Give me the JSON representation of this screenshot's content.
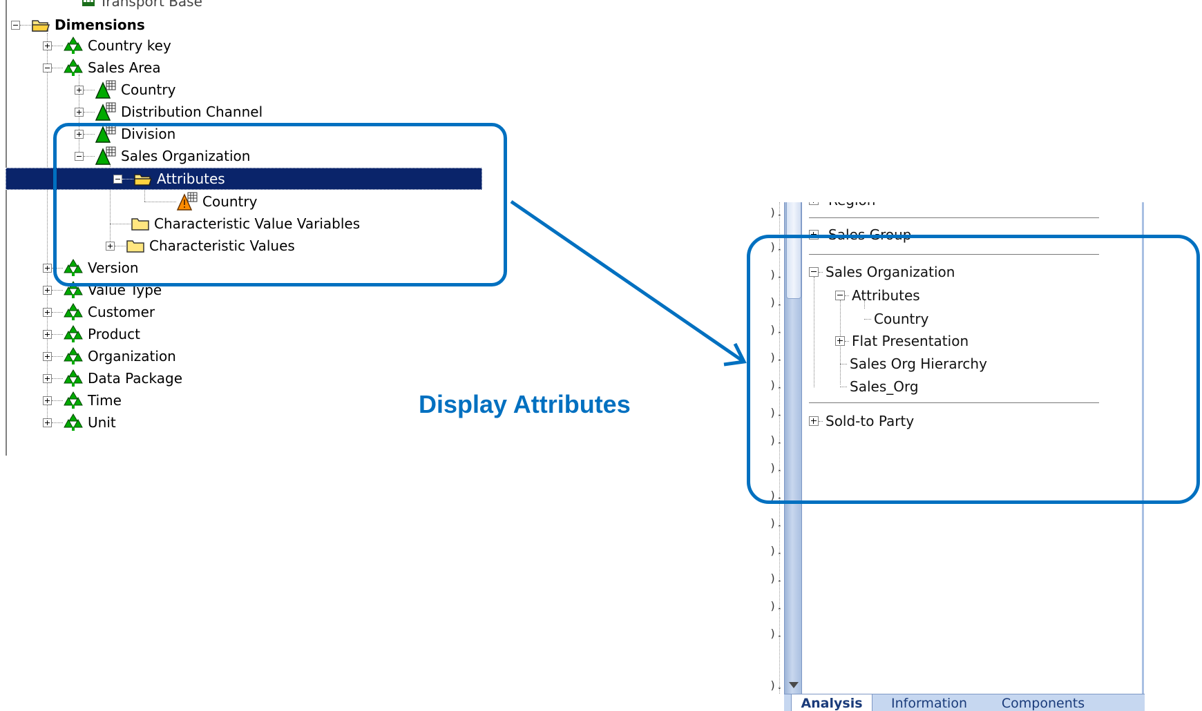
{
  "left_tree": {
    "top_partial_label": "Transport Base",
    "nodes": [
      {
        "label": "Dimensions"
      },
      {
        "label": "Country key"
      },
      {
        "label": "Sales Area"
      },
      {
        "label": "Country"
      },
      {
        "label": "Distribution Channel"
      },
      {
        "label": "Division"
      },
      {
        "label": "Sales Organization"
      },
      {
        "label": "Attributes"
      },
      {
        "label": "Country"
      },
      {
        "label": "Characteristic Value Variables"
      },
      {
        "label": "Characteristic Values"
      },
      {
        "label": "Version"
      },
      {
        "label": "Value Type"
      },
      {
        "label": "Customer"
      },
      {
        "label": "Product"
      },
      {
        "label": "Organization"
      },
      {
        "label": "Data Package"
      },
      {
        "label": "Time"
      },
      {
        "label": "Unit"
      }
    ]
  },
  "caption": "Display Attributes",
  "right_panel": {
    "partial_top_label": "Region",
    "nodes": [
      {
        "label": "Sales Group"
      },
      {
        "label": "Sales Organization"
      },
      {
        "label": "Attributes"
      },
      {
        "label": "Country"
      },
      {
        "label": "Flat Presentation"
      },
      {
        "label": "Sales Org Hierarchy"
      },
      {
        "label": "Sales_Org"
      },
      {
        "label": "Sold-to Party"
      }
    ],
    "gutter_marks": [
      ").",
      ").",
      ").",
      ").",
      ").",
      ").",
      ").",
      ").",
      ").",
      ").",
      ").",
      ").",
      ").",
      ").",
      ").",
      ").",
      ")."
    ],
    "tabs": [
      {
        "label": "Analysis",
        "active": true
      },
      {
        "label": "Information",
        "active": false
      },
      {
        "label": "Components",
        "active": false
      }
    ]
  },
  "colors": {
    "callout": "#0070c0",
    "selection": "#0a246a",
    "dimension_icon": "#00aa00",
    "folder": "#ffe680"
  },
  "icons": {
    "dimension": "green-hierarchy-icon",
    "characteristic": "green-triangle-grid-icon",
    "attribute": "orange-triangle-grid-icon",
    "folder": "yellow-folder-icon"
  }
}
